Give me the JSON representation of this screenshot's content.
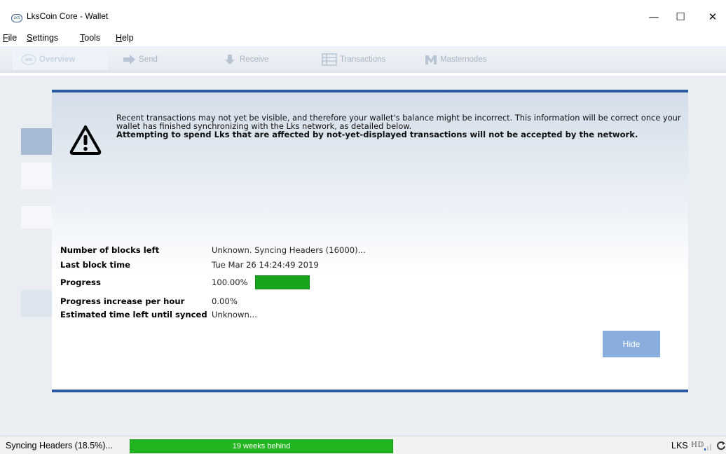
{
  "window": {
    "title": "LksCoin Core - Wallet",
    "app_icon_text": "LKS",
    "minimize_glyph": "—",
    "maximize_glyph": "☐",
    "close_glyph": "✕"
  },
  "menu": {
    "items": [
      {
        "mnemonic": "F",
        "rest": "ile"
      },
      {
        "mnemonic": "S",
        "rest": "ettings"
      },
      {
        "mnemonic": "T",
        "rest": "ools"
      },
      {
        "mnemonic": "H",
        "rest": "elp"
      }
    ]
  },
  "nav": {
    "tabs": [
      {
        "label": "Overview",
        "icon": "lks-logo-icon",
        "active": true
      },
      {
        "label": "Send",
        "icon": "send-arrow-icon"
      },
      {
        "label": "Receive",
        "icon": "receive-icon"
      },
      {
        "label": "Transactions",
        "icon": "transactions-list-icon"
      },
      {
        "label": "Masternodes",
        "icon": "masternodes-icon"
      }
    ]
  },
  "sync_modal": {
    "notice_text": "Recent transactions may not yet be visible, and therefore your wallet's balance might be incorrect. This information will be correct once your wallet has finished synchronizing with the Lks network, as detailed below.",
    "notice_bold": "Attempting to spend Lks that are affected by not-yet-displayed transactions will not be accepted by the network.",
    "rows": [
      {
        "label": "Number of blocks left",
        "value": "Unknown. Syncing Headers (16000)..."
      },
      {
        "label": "Last block time",
        "value": "Tue Mar 26 14:24:49 2019"
      },
      {
        "label": "Progress",
        "value": "100.00%"
      },
      {
        "label": "Progress increase per hour",
        "value": "0.00%"
      },
      {
        "label": "Estimated time left until synced",
        "value": "Unknown..."
      }
    ],
    "progress_fraction": 1.0,
    "hide_label": "Hide",
    "accent_color": "#2b5aa3"
  },
  "status": {
    "sync_label": "Syncing Headers (18.5%)...",
    "progress_text": "19 weeks behind",
    "progress_color": "#22b51f",
    "unit": "LKS",
    "hd_glyph": "ℍ𝔻"
  }
}
